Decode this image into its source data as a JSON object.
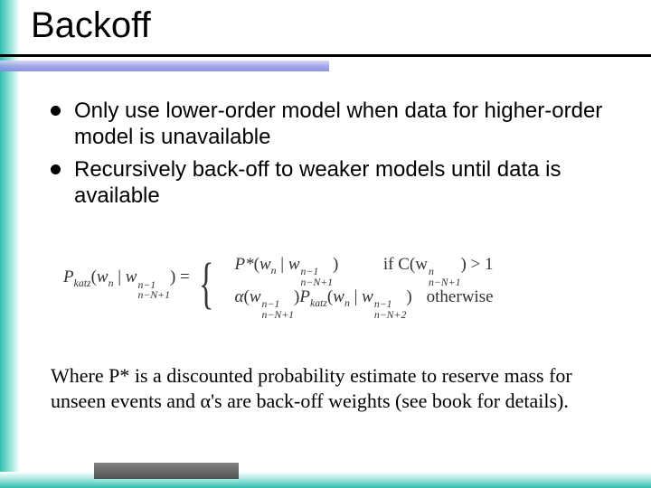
{
  "title": "Backoff",
  "bullets": [
    "Only use lower-order model when data for higher-order model is unavailable",
    "Recursively back-off to weaker models until data is available"
  ],
  "formula": {
    "lhs_P": "P",
    "lhs_katz": "katz",
    "lhs_open": "(",
    "lhs_w": "w",
    "lhs_n": "n",
    "lhs_bar": " | ",
    "lhs_w2": "w",
    "lhs_sup": "n−1",
    "lhs_sub": "n−N+1",
    "lhs_close": ") = ",
    "case1_Pstar": "P*",
    "case1_open": "(",
    "case1_w": "w",
    "case1_n": "n",
    "case1_bar": " | ",
    "case1_w2": "w",
    "case1_sup": "n−1",
    "case1_sub": "n−N+1",
    "case1_close": ")",
    "case1_cond_if": "if ",
    "case1_cond_C": "C",
    "case1_cond_open": "(",
    "case1_cond_w": "w",
    "case1_cond_sup": "n",
    "case1_cond_sub": "n−N+1",
    "case1_cond_close": ") > 1",
    "case2_alpha": "α",
    "case2_open": "(",
    "case2_w": "w",
    "case2_sup": "n−1",
    "case2_sub": "n−N+1",
    "case2_close1": ")",
    "case2_P": "P",
    "case2_katz": "katz",
    "case2_open2": "(",
    "case2_w2": "w",
    "case2_n": "n",
    "case2_bar": " | ",
    "case2_w3": "w",
    "case2_sup2": "n−1",
    "case2_sub2": "n−N+2",
    "case2_close2": ")",
    "case2_cond": "otherwise"
  },
  "note": "Where P* is a discounted probability estimate to reserve mass for unseen events and α's are back-off weights (see book for details)."
}
